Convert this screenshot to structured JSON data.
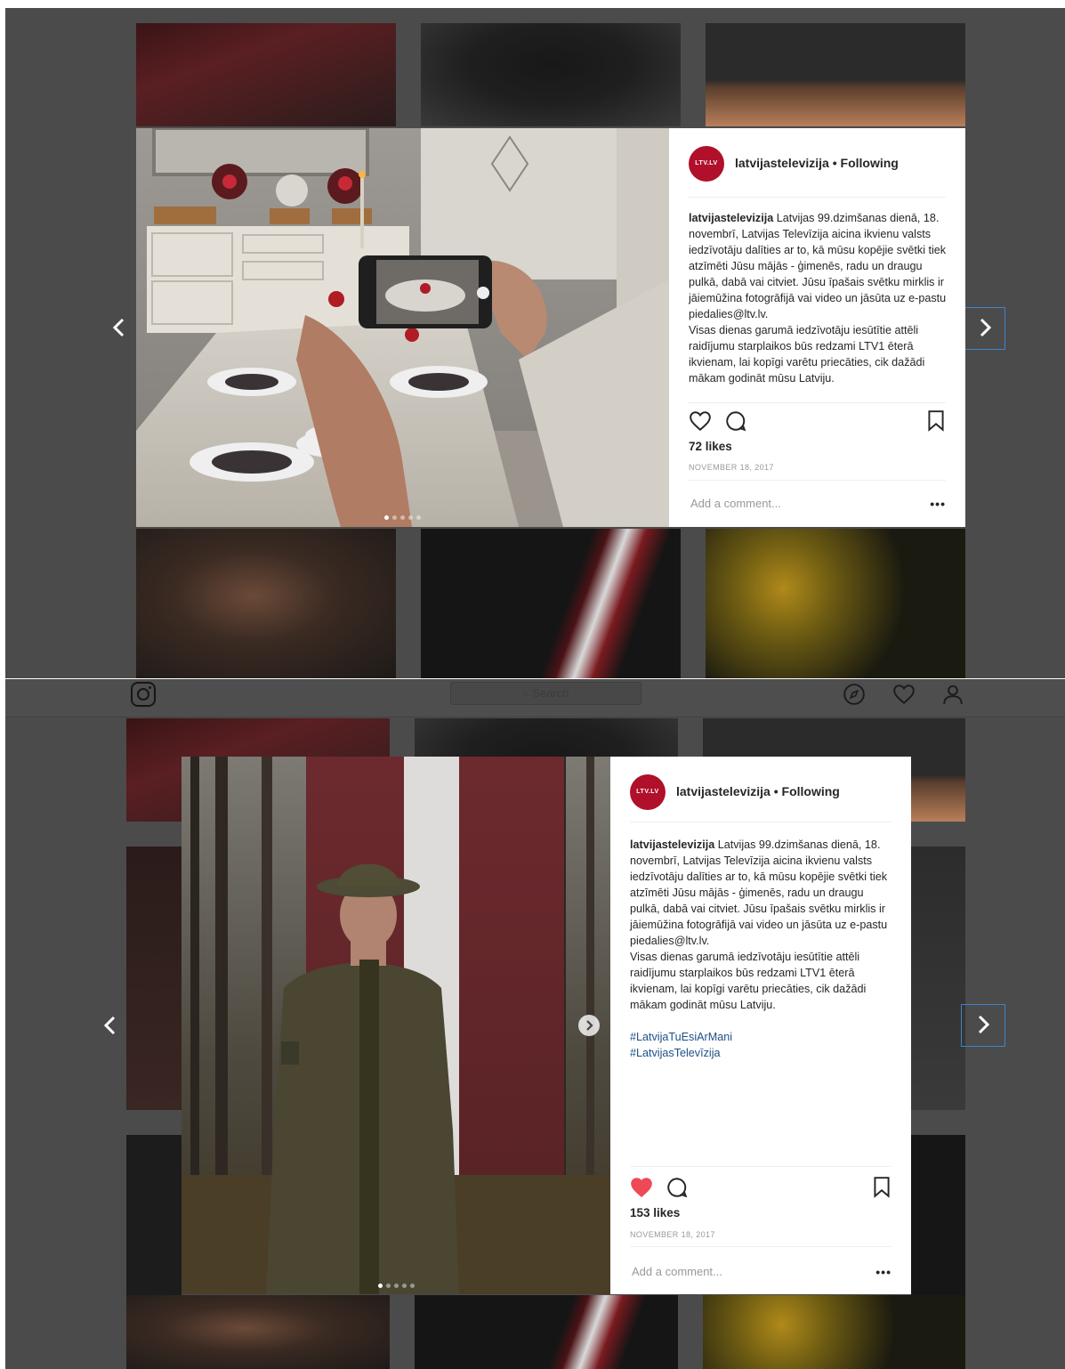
{
  "colors": {
    "overlay": "#4b4b4b",
    "accent_blue": "#3b86c7",
    "avatar_red": "#b0102a",
    "like_red": "#ed4956",
    "hashtag_blue": "#1f4f86"
  },
  "topbar": {
    "search_placeholder": "Search",
    "icons": [
      "instagram-logo-icon",
      "compass-icon",
      "heart-icon",
      "user-icon"
    ]
  },
  "post1": {
    "username": "latvijastelevizija",
    "follow_status": "• Following",
    "avatar_text": "LTV.LV",
    "caption_user": "latvijastelevizija",
    "caption_line1": "Latvijas 99.dzimšanas dienā, 18. novembrī, Latvijas Televīzija aicina ikvienu valsts iedzīvotāju dalīties ar to, kā mūsu kopējie svētki tiek atzīmēti Jūsu mājās - ģimenēs, radu un draugu pulkā, dabā vai citviet. Jūsu īpašais svētku mirklis ir jāiemūžina fotogrāfijā vai video un jāsūta uz e-pastu piedalies@ltv.lv.",
    "caption_line2": "Visas dienas garumā iedzīvotāju iesūtītie attēli raidījumu starplaikos būs redzami LTV1 ēterā ikvienam, lai kopīgi varētu priecāties, cik dažādi mākam godināt mūsu Latviju.",
    "likes": "72 likes",
    "date": "NOVEMBER 18, 2017",
    "comment_placeholder": "Add a comment...",
    "more_label": "•••",
    "liked": false,
    "carousel_dots": 5,
    "carousel_active": 0
  },
  "post2": {
    "username": "latvijastelevizija",
    "follow_status": "• Following",
    "avatar_text": "LTV.LV",
    "caption_user": "latvijastelevizija",
    "caption_line1": "Latvijas 99.dzimšanas dienā, 18. novembrī, Latvijas Televīzija aicina ikvienu valsts iedzīvotāju dalīties ar to, kā mūsu kopējie svētki tiek atzīmēti Jūsu mājās - ģimenēs, radu un draugu pulkā, dabā vai citviet. Jūsu īpašais svētku mirklis ir jāiemūžina fotogrāfijā vai video un jāsūta uz e-pastu piedalies@ltv.lv.",
    "caption_line2": "Visas dienas garumā iedzīvotāju iesūtītie attēli raidījumu starplaikos būs redzami LTV1 ēterā ikvienam, lai kopīgi varētu priecāties, cik dažādi mākam godināt mūsu Latviju.",
    "hashtags": [
      "#LatvijaTuEsiArMani",
      "#LatvijasTelevīzija"
    ],
    "likes": "153 likes",
    "date": "NOVEMBER 18, 2017",
    "comment_placeholder": "Add a comment...",
    "more_label": "•••",
    "liked": true,
    "carousel_dots": 5,
    "carousel_active": 0
  }
}
